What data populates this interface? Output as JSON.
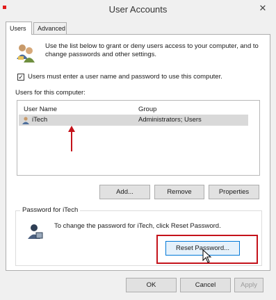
{
  "window": {
    "title": "User Accounts",
    "close_glyph": "✕"
  },
  "tabs": [
    {
      "label": "Users",
      "active": true
    },
    {
      "label": "Advanced",
      "active": false
    }
  ],
  "intro": {
    "icon": "users-icon",
    "text": "Use the list below to grant or deny users access to your computer, and to change passwords and other settings."
  },
  "require_login": {
    "checked": true,
    "label": "Users must enter a user name and password to use this computer."
  },
  "users_label": "Users for this computer:",
  "user_list": {
    "columns": [
      "User Name",
      "Group"
    ],
    "rows": [
      {
        "user": "iTech",
        "group": "Administrators; Users",
        "icon": "user-icon",
        "selected": true
      }
    ]
  },
  "list_buttons": {
    "add": "Add...",
    "remove": "Remove",
    "properties": "Properties"
  },
  "password_group": {
    "legend": "Password for iTech",
    "icon": "user-password-icon",
    "text": "To change the password for iTech, click Reset Password.",
    "reset_button": "Reset Password..."
  },
  "footer_buttons": {
    "ok": "OK",
    "cancel": "Cancel",
    "apply": "Apply",
    "apply_enabled": false
  },
  "colors": {
    "highlight": "#c4121a",
    "selection": "#d9d9d9",
    "focus": "#0078d7"
  }
}
